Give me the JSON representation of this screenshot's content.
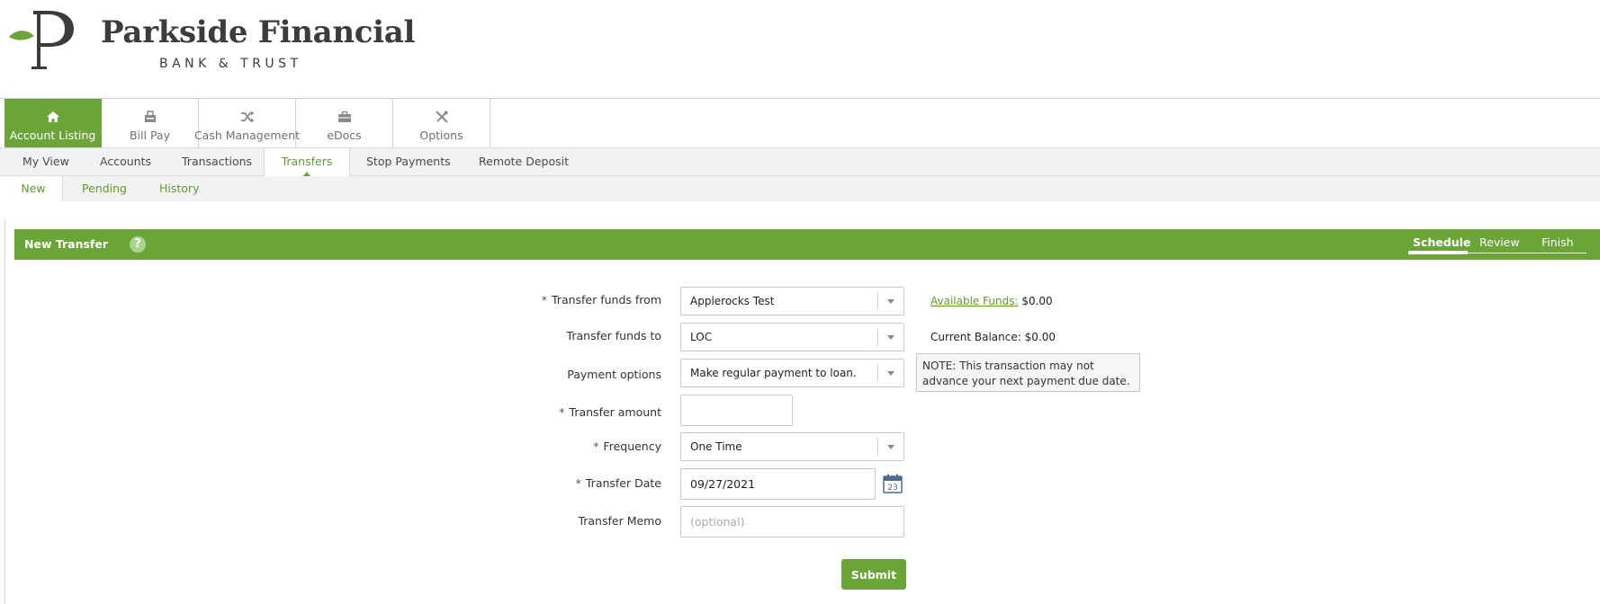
{
  "brand": {
    "name": "Parkside Financial",
    "sub": "BANK & TRUST",
    "accent_color": "#6ba539"
  },
  "top_nav": [
    {
      "label": "Account Listing",
      "icon": "home-icon",
      "active": true
    },
    {
      "label": "Bill Pay",
      "icon": "bill-pay-icon"
    },
    {
      "label": "Cash Management",
      "icon": "shuffle-icon"
    },
    {
      "label": "eDocs",
      "icon": "briefcase-icon"
    },
    {
      "label": "Options",
      "icon": "tools-icon"
    }
  ],
  "sub_nav": [
    {
      "label": "My View"
    },
    {
      "label": "Accounts"
    },
    {
      "label": "Transactions"
    },
    {
      "label": "Transfers",
      "active": true
    },
    {
      "label": "Stop Payments"
    },
    {
      "label": "Remote Deposit"
    }
  ],
  "transfer_tabs": [
    {
      "label": "New",
      "active": true
    },
    {
      "label": "Pending"
    },
    {
      "label": "History"
    }
  ],
  "panel": {
    "title": "New Transfer",
    "help": "?",
    "steps": [
      {
        "label": "Schedule",
        "active": true
      },
      {
        "label": "Review"
      },
      {
        "label": "Finish"
      }
    ]
  },
  "form": {
    "from": {
      "label": "Transfer funds from",
      "value": "Applerocks Test",
      "required": "*"
    },
    "to": {
      "label": "Transfer funds to",
      "value": "LOC"
    },
    "payment_options": {
      "label": "Payment options",
      "value": "Make regular payment to loan."
    },
    "amount": {
      "label": "Transfer amount",
      "value": "",
      "required": "*"
    },
    "frequency": {
      "label": "Frequency",
      "value": "One Time",
      "required": "*"
    },
    "date": {
      "label": "Transfer Date",
      "value": "09/27/2021",
      "required": "*",
      "calendar_day": "23"
    },
    "memo": {
      "label": "Transfer Memo",
      "placeholder": "(optional)"
    },
    "submit": "Submit"
  },
  "side": {
    "available_label": "Available Funds:",
    "available_value": "$0.00",
    "current_label": "Current Balance:",
    "current_value": "$0.00",
    "note": "NOTE: This transaction may not advance your next payment due date."
  }
}
